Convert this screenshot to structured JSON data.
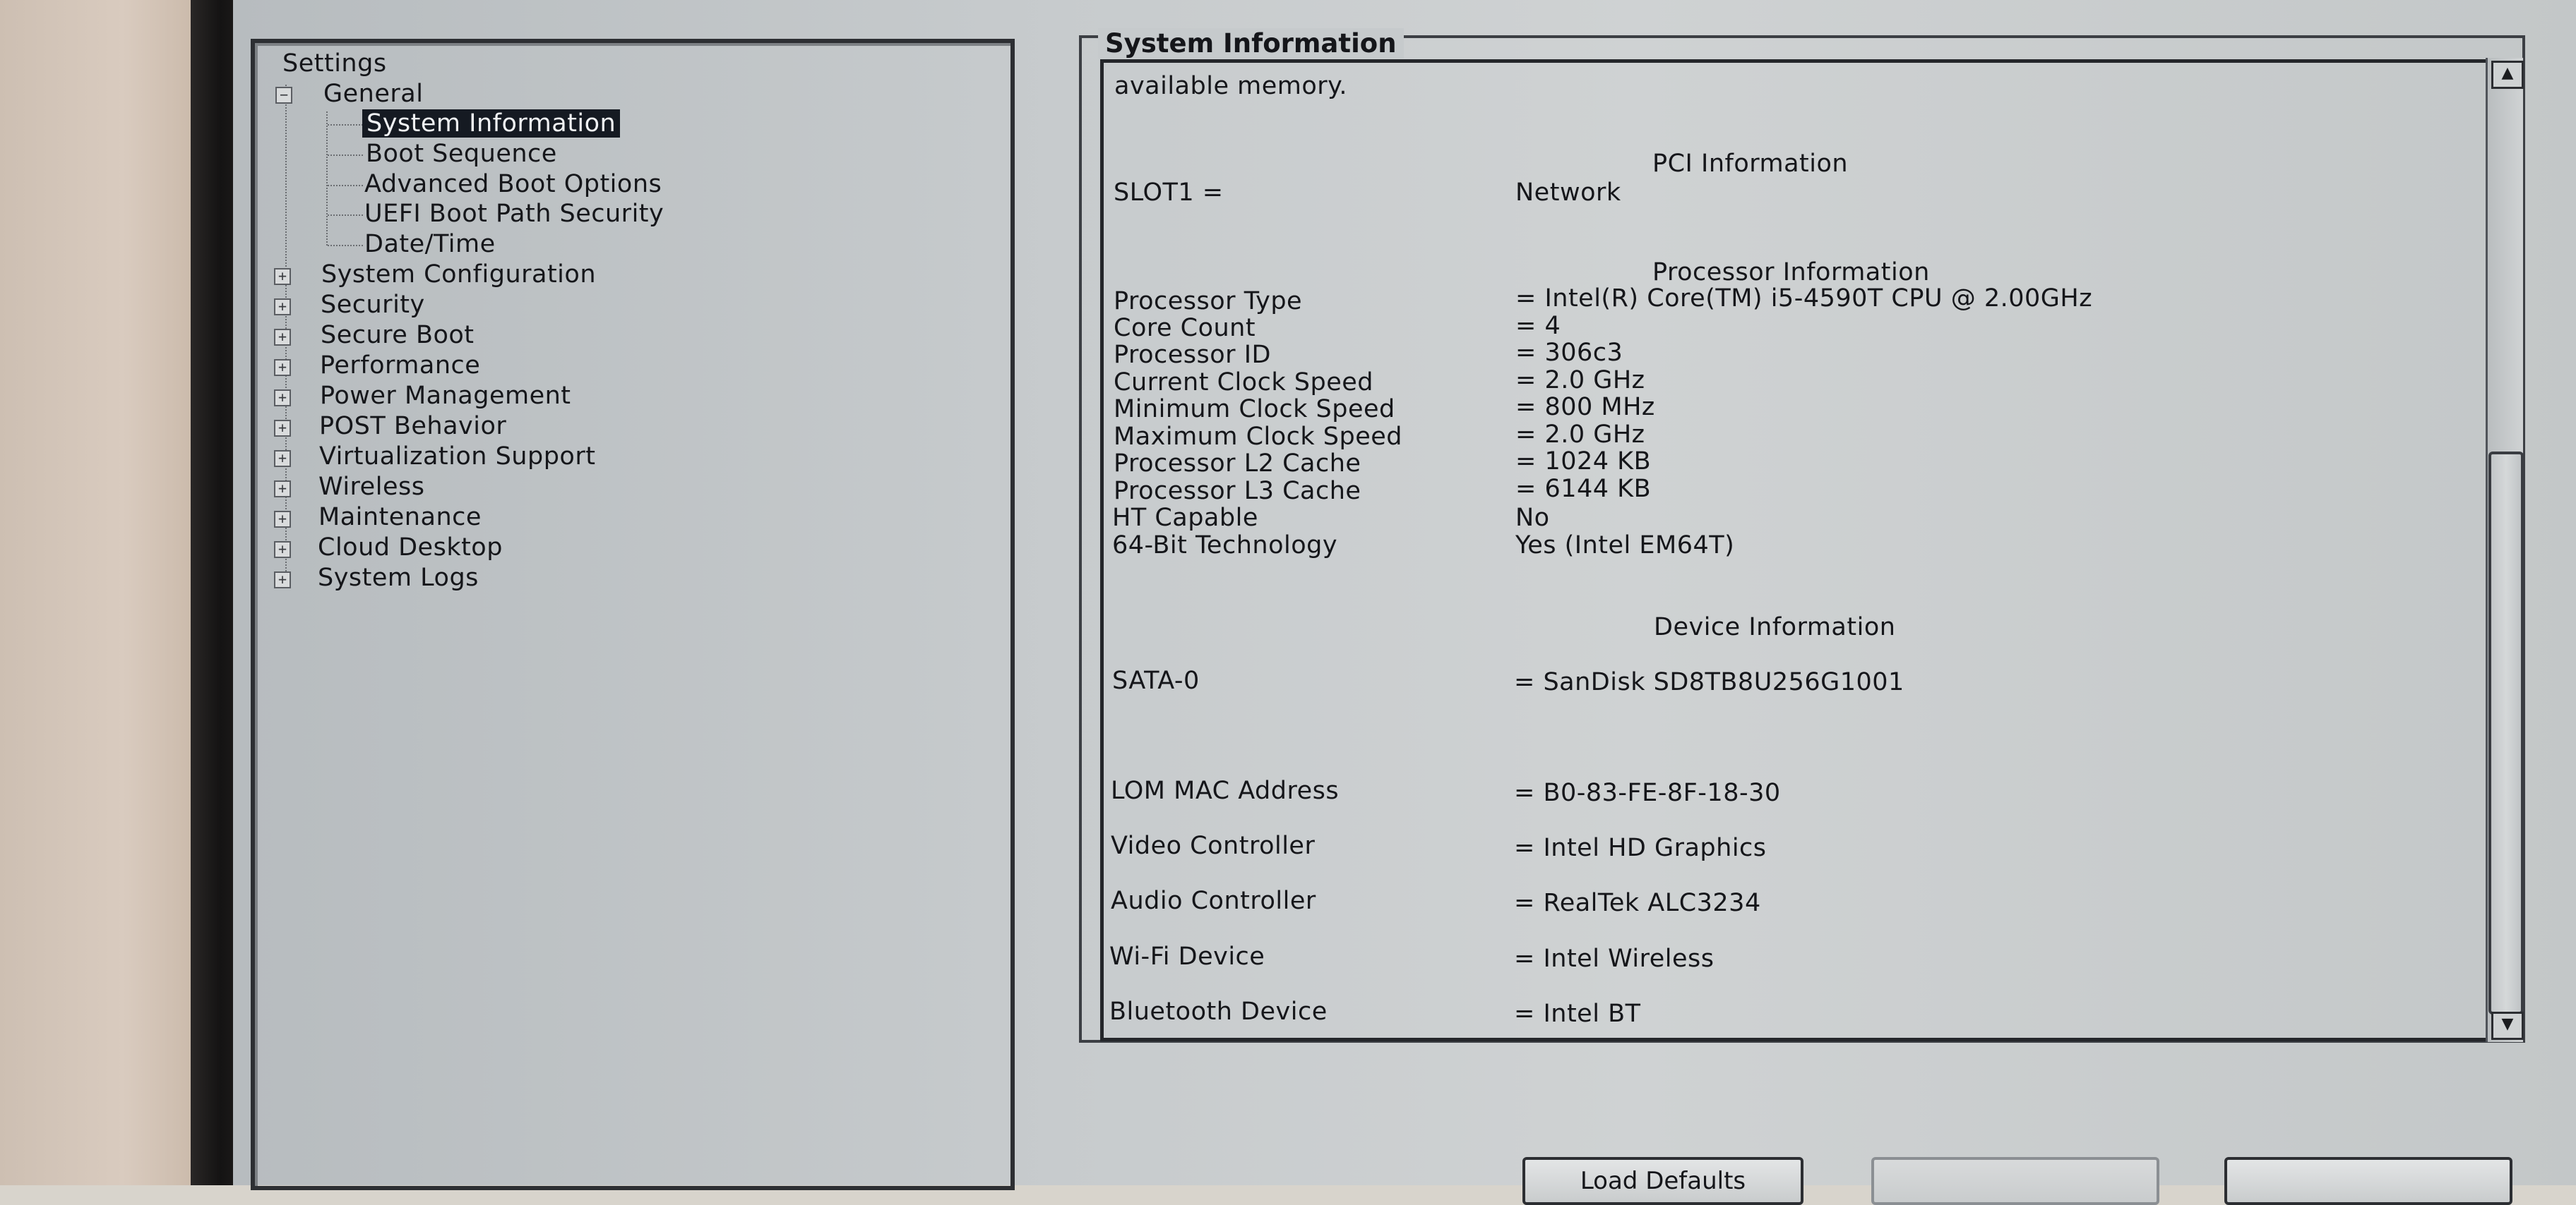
{
  "tree": {
    "root": "Settings",
    "general": {
      "label": "General",
      "children": [
        "System Information",
        "Boot Sequence",
        "Advanced Boot Options",
        "UEFI Boot Path Security",
        "Date/Time"
      ],
      "selected": "System Information"
    },
    "groups": [
      "System Configuration",
      "Security",
      "Secure Boot",
      "Performance",
      "Power Management",
      "POST Behavior",
      "Virtualization Support",
      "Wireless",
      "Maintenance",
      "Cloud Desktop",
      "System Logs"
    ]
  },
  "panel": {
    "title": "System Information",
    "memory_tail": "available memory.",
    "pci_header": "PCI Information",
    "slot1_label": "SLOT1 =",
    "slot1_value": "Network",
    "processor_header": "Processor Information",
    "processor": [
      {
        "label": "Processor Type",
        "value": "= Intel(R) Core(TM) i5-4590T CPU @ 2.00GHz"
      },
      {
        "label": "Core Count",
        "value": "= 4"
      },
      {
        "label": "Processor ID",
        "value": "= 306c3"
      },
      {
        "label": "Current Clock Speed",
        "value": "= 2.0 GHz"
      },
      {
        "label": "Minimum Clock Speed",
        "value": "= 800 MHz"
      },
      {
        "label": "Maximum Clock Speed",
        "value": "= 2.0 GHz"
      },
      {
        "label": "Processor L2 Cache",
        "value": "= 1024 KB"
      },
      {
        "label": "Processor L3 Cache",
        "value": "= 6144 KB"
      },
      {
        "label": "HT Capable",
        "value": "No"
      },
      {
        "label": "64-Bit Technology",
        "value": "Yes (Intel EM64T)"
      }
    ],
    "device_header": "Device Information",
    "devices": [
      {
        "label": "SATA-0",
        "value": "= SanDisk SD8TB8U256G1001"
      },
      {
        "label": "LOM MAC Address",
        "value": "= B0-83-FE-8F-18-30"
      },
      {
        "label": "Video Controller",
        "value": "= Intel HD Graphics"
      },
      {
        "label": "Audio Controller",
        "value": "= RealTek ALC3234"
      },
      {
        "label": "Wi-Fi Device",
        "value": "= Intel Wireless"
      },
      {
        "label": "Bluetooth Device",
        "value": "= Intel BT"
      }
    ]
  },
  "scrollbar": {
    "up_glyph": "▲",
    "down_glyph": "▼"
  },
  "buttons": {
    "load_defaults": "Load Defaults"
  }
}
